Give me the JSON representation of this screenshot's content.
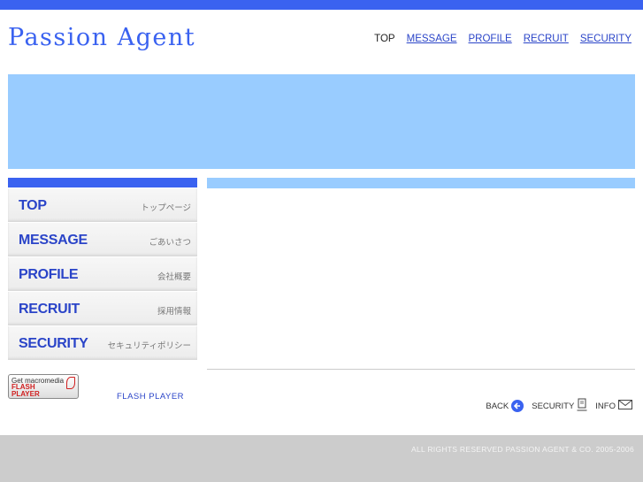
{
  "header": {
    "logo": "Passion Agent",
    "nav": [
      {
        "label": "TOP",
        "current": true
      },
      {
        "label": "MESSAGE"
      },
      {
        "label": "PROFILE"
      },
      {
        "label": "RECRUIT"
      },
      {
        "label": "SECURITY"
      }
    ]
  },
  "sidebar": {
    "items": [
      {
        "en": "TOP",
        "jp": "トップページ"
      },
      {
        "en": "MESSAGE",
        "jp": "ごあいさつ"
      },
      {
        "en": "PROFILE",
        "jp": "会社概要"
      },
      {
        "en": "RECRUIT",
        "jp": "採用情報"
      },
      {
        "en": "SECURITY",
        "jp": "セキュリティポリシー"
      }
    ]
  },
  "flash": {
    "badge_line1": "Get macromedia",
    "badge_line2": "FLASH",
    "badge_line3": "PLAYER",
    "label": "FLASH PLAYER"
  },
  "bottom_links": {
    "back": "BACK",
    "security": "SECURITY",
    "info": "INFO"
  },
  "footer": {
    "copyright": "ALL RIGHTS RESERVED PASSION AGENT & CO. 2005-2006"
  },
  "colors": {
    "accent_blue": "#3a62f0",
    "banner_light_blue": "#99ccff",
    "footer_gray": "#cccccc"
  }
}
